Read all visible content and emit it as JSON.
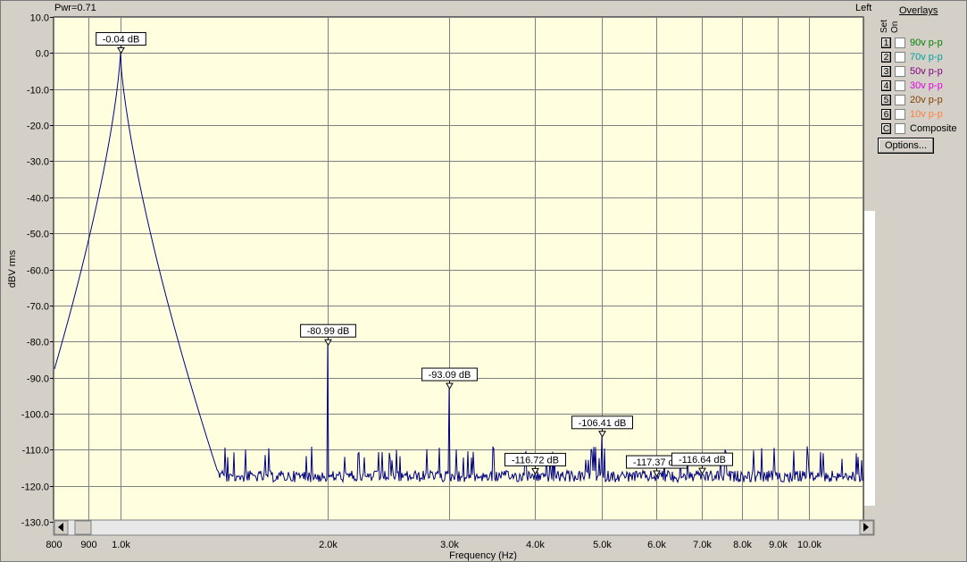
{
  "header": {
    "power_label": "Pwr=0.71",
    "channel": "Left"
  },
  "overlays": {
    "title": "Overlays",
    "set_label": "Set",
    "on_label": "On",
    "items": [
      {
        "key": "1",
        "label": "90v p-p",
        "color": "#008000"
      },
      {
        "key": "2",
        "label": "70v p-p",
        "color": "#00a0a0"
      },
      {
        "key": "3",
        "label": "50v p-p",
        "color": "#800080"
      },
      {
        "key": "4",
        "label": "30v p-p",
        "color": "#e000e0"
      },
      {
        "key": "5",
        "label": "20v p-p",
        "color": "#804000"
      },
      {
        "key": "6",
        "label": "10v p-p",
        "color": "#ff8040"
      },
      {
        "key": "C",
        "label": "Composite",
        "color": "#000000"
      }
    ],
    "options_label": "Options..."
  },
  "chart_data": {
    "type": "line",
    "xlabel": "Frequency (Hz)",
    "ylabel": "dBV rms",
    "x_scale": "log",
    "xlim": [
      800,
      12000
    ],
    "ylim": [
      -130,
      10
    ],
    "yticks": [
      10,
      0,
      -10,
      -20,
      -30,
      -40,
      -50,
      -60,
      -70,
      -80,
      -90,
      -100,
      -110,
      -120,
      -130
    ],
    "ytick_labels": [
      "10.0",
      "0.0",
      "-10.0",
      "-20.0",
      "-30.0",
      "-40.0",
      "-50.0",
      "-60.0",
      "-70.0",
      "-80.0",
      "-90.0",
      "-100.0",
      "-110.0",
      "-120.0",
      "-130.0"
    ],
    "xticks": [
      800,
      900,
      1000,
      2000,
      3000,
      4000,
      5000,
      6000,
      7000,
      8000,
      9000,
      10000
    ],
    "xtick_labels": [
      "800",
      "900",
      "1.0k",
      "2.0k",
      "3.0k",
      "4.0k",
      "5.0k",
      "6.0k",
      "7.0k",
      "8.0k",
      "9.0k",
      "10.0k"
    ],
    "grid": true,
    "background": "#ffffe0",
    "line_color": "#000080",
    "noise_floor_db": -115,
    "peaks": [
      {
        "freq": 1000,
        "db": -0.04,
        "label": "-0.04 dB"
      },
      {
        "freq": 2000,
        "db": -80.99,
        "label": "-80.99 dB"
      },
      {
        "freq": 3000,
        "db": -93.09,
        "label": "-93.09 dB"
      },
      {
        "freq": 4000,
        "db": -116.72,
        "label": "-116.72 dB"
      },
      {
        "freq": 5000,
        "db": -106.41,
        "label": "-106.41 dB"
      },
      {
        "freq": 6000,
        "db": -117.37,
        "label": "-117.37 dB"
      },
      {
        "freq": 7000,
        "db": -116.64,
        "label": "-116.64 dB"
      }
    ]
  }
}
